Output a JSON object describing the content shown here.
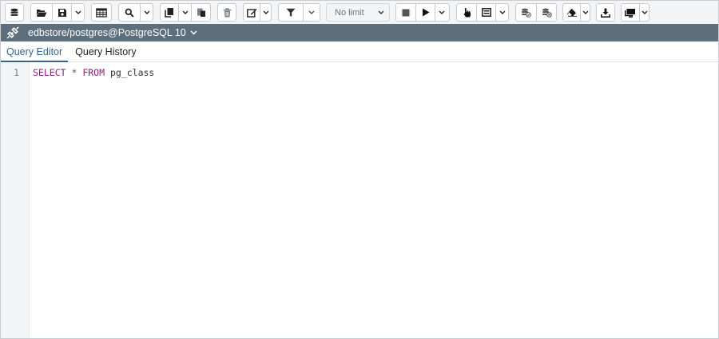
{
  "toolbar": {
    "limit_select": {
      "value": "No limit"
    }
  },
  "connection": {
    "label": "edbstore/postgres@PostgreSQL 10"
  },
  "tabs": [
    {
      "label": "Query Editor",
      "active": true
    },
    {
      "label": "Query History",
      "active": false
    }
  ],
  "editor": {
    "lines": [
      {
        "number": "1",
        "tokens": [
          {
            "text": "SELECT",
            "type": "keyword"
          },
          {
            "text": " * ",
            "type": "operator"
          },
          {
            "text": "FROM",
            "type": "keyword"
          },
          {
            "text": " pg_class",
            "type": "identifier"
          }
        ]
      }
    ]
  },
  "colors": {
    "connection_bar": "#5d6f7d",
    "active_tab": "#326690",
    "keyword": "#8c1e7a",
    "toolbar_bg": "#f3f4f5"
  },
  "icons": [
    "database-icon",
    "folder-open-icon",
    "save-icon",
    "chevron-down-icon",
    "table-icon",
    "search-icon",
    "copy-icon",
    "paste-icon",
    "trash-icon",
    "edit-icon",
    "filter-icon",
    "stop-icon",
    "play-icon",
    "pointer-icon",
    "explain-icon",
    "commit-icon",
    "rollback-icon",
    "eraser-icon",
    "download-icon",
    "macro-icon",
    "connection-icon"
  ]
}
